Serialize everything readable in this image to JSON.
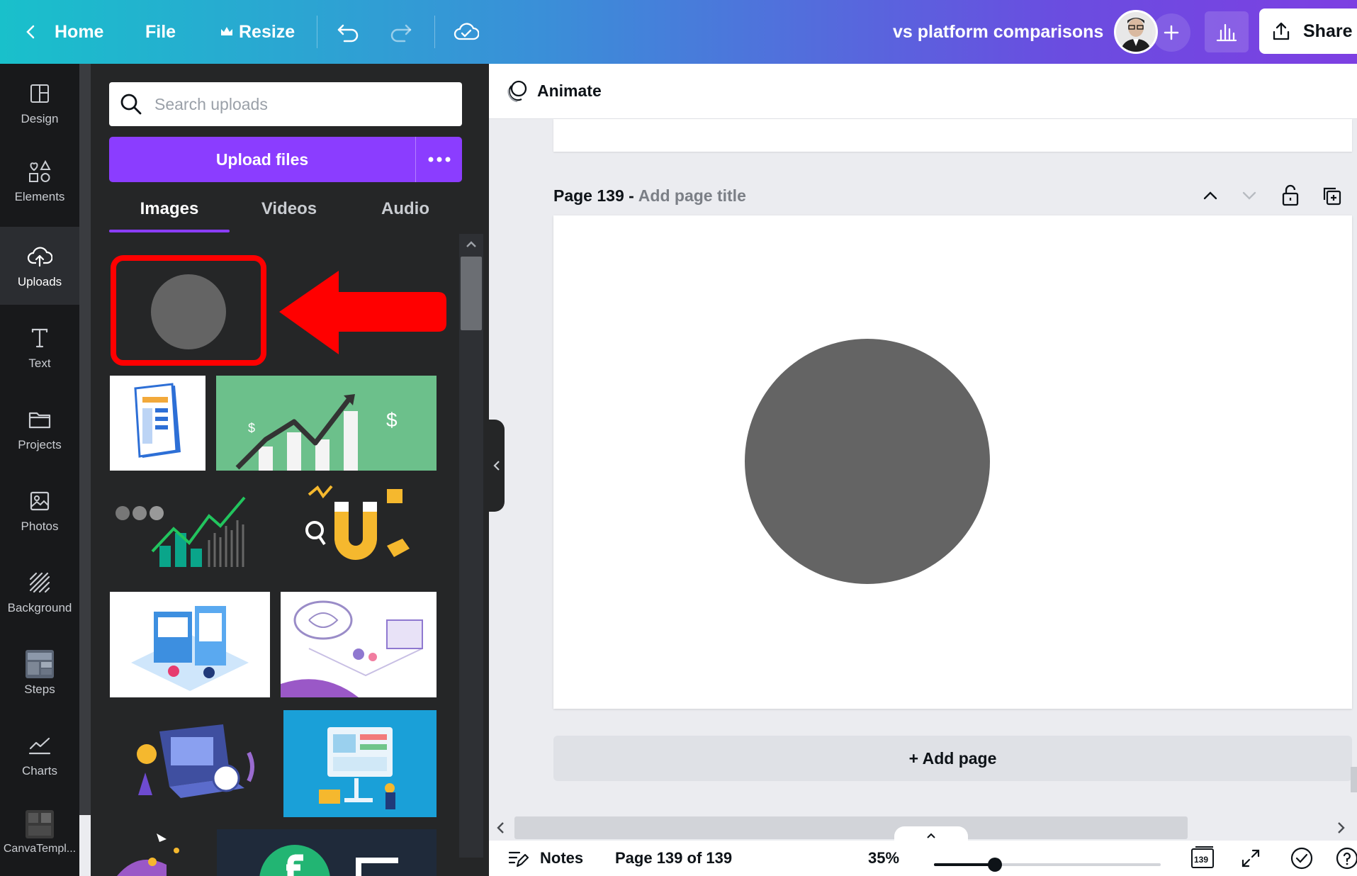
{
  "topbar": {
    "home_label": "Home",
    "file_label": "File",
    "resize_label": "Resize",
    "doc_title": "vs platform comparisons",
    "share_label": "Share"
  },
  "rail": {
    "items": [
      {
        "label": "Design",
        "icon": "layout-icon"
      },
      {
        "label": "Elements",
        "icon": "shapes-icon"
      },
      {
        "label": "Uploads",
        "icon": "cloud-upload-icon",
        "active": true
      },
      {
        "label": "Text",
        "icon": "text-icon"
      },
      {
        "label": "Projects",
        "icon": "folder-icon"
      },
      {
        "label": "Photos",
        "icon": "photo-icon"
      },
      {
        "label": "Background",
        "icon": "background-pattern-icon"
      },
      {
        "label": "Steps",
        "icon": "steps-app-icon"
      },
      {
        "label": "Charts",
        "icon": "line-chart-icon"
      },
      {
        "label": "CanvaTempl...",
        "icon": "canva-template-app-icon"
      }
    ]
  },
  "panel": {
    "search_placeholder": "Search uploads",
    "upload_label": "Upload files",
    "tabs": [
      "Images",
      "Videos",
      "Audio"
    ],
    "active_tab": "Images"
  },
  "editor": {
    "animate_label": "Animate",
    "page_number_label": "Page 139 -",
    "page_title_placeholder": "Add page title",
    "add_page_label": "+ Add page"
  },
  "footer": {
    "notes_label": "Notes",
    "page_indicator": "Page 139 of 139",
    "zoom": "35%",
    "zoom_fraction": 0.27,
    "page_count_badge": "139"
  },
  "colors": {
    "accent": "#8b3dff",
    "highlight_red": "#ff0000",
    "shape_gray": "#646464"
  }
}
